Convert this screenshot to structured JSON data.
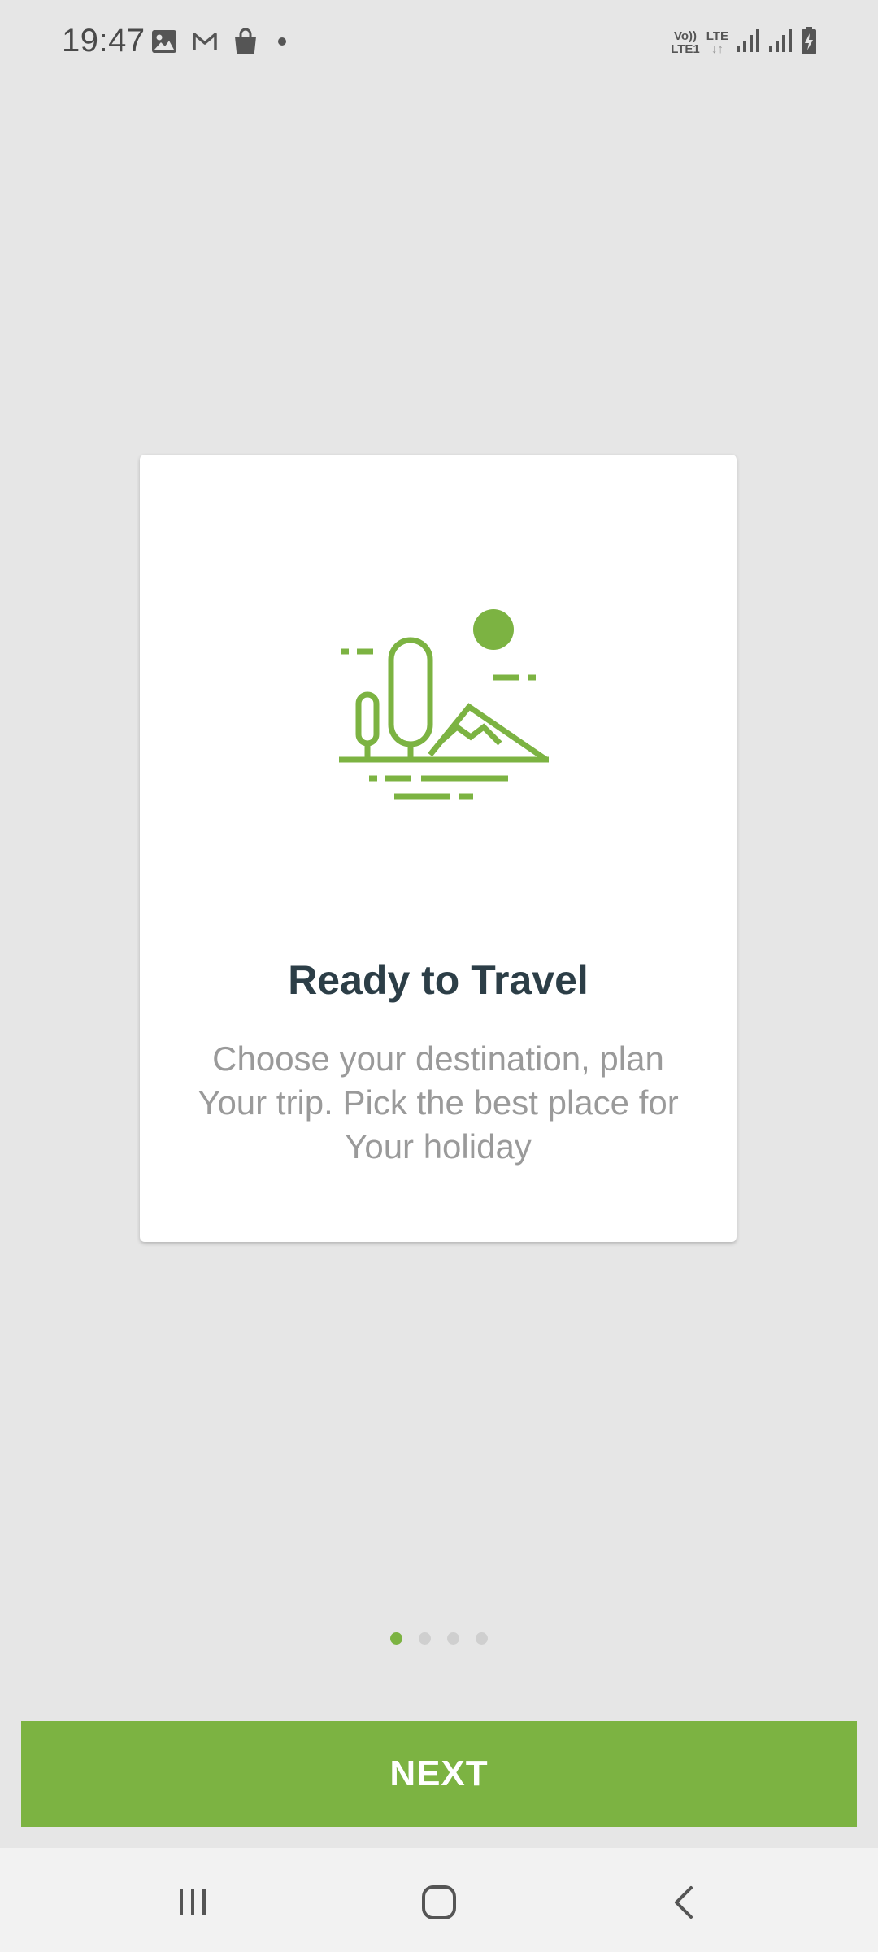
{
  "status_bar": {
    "time": "19:47",
    "network_volte": "Vo))",
    "network_lte1": "LTE1",
    "network_lte": "LTE",
    "icons": [
      "gallery-icon",
      "gmail-icon",
      "shopping-bag-icon",
      "notification-dot-icon",
      "signal-icon",
      "signal-icon",
      "battery-charging-icon"
    ]
  },
  "onboarding": {
    "illustration_icon": "landscape-travel-icon",
    "title": "Ready to Travel",
    "description": "Choose your destination, plan Your trip. Pick the best place for Your holiday",
    "page_count": 4,
    "current_page": 1
  },
  "actions": {
    "next_label": "NEXT"
  },
  "nav_bar": {
    "icons": [
      "recents-icon",
      "home-icon",
      "back-icon"
    ]
  },
  "colors": {
    "accent": "#7cb342",
    "background": "#e6e6e6",
    "title": "#2c3e47",
    "description": "#9a9a9a"
  }
}
